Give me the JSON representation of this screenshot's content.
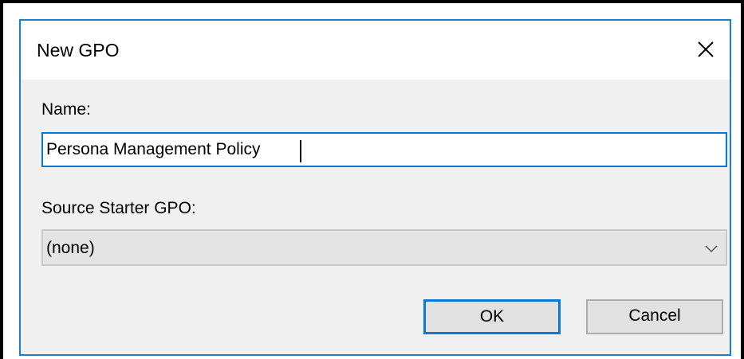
{
  "window": {
    "title": "New GPO",
    "close_icon": "close-icon"
  },
  "form": {
    "name_label": "Name:",
    "name_value": "Persona Management Policy",
    "source_label": "Source Starter GPO:",
    "source_value": "(none)",
    "dropdown_icon": "chevron-down-icon"
  },
  "buttons": {
    "ok_label": "OK",
    "cancel_label": "Cancel"
  },
  "colors": {
    "accent": "#0a78d4",
    "dialog_background": "#f0f0f0",
    "button_background": "#e1e1e1"
  }
}
